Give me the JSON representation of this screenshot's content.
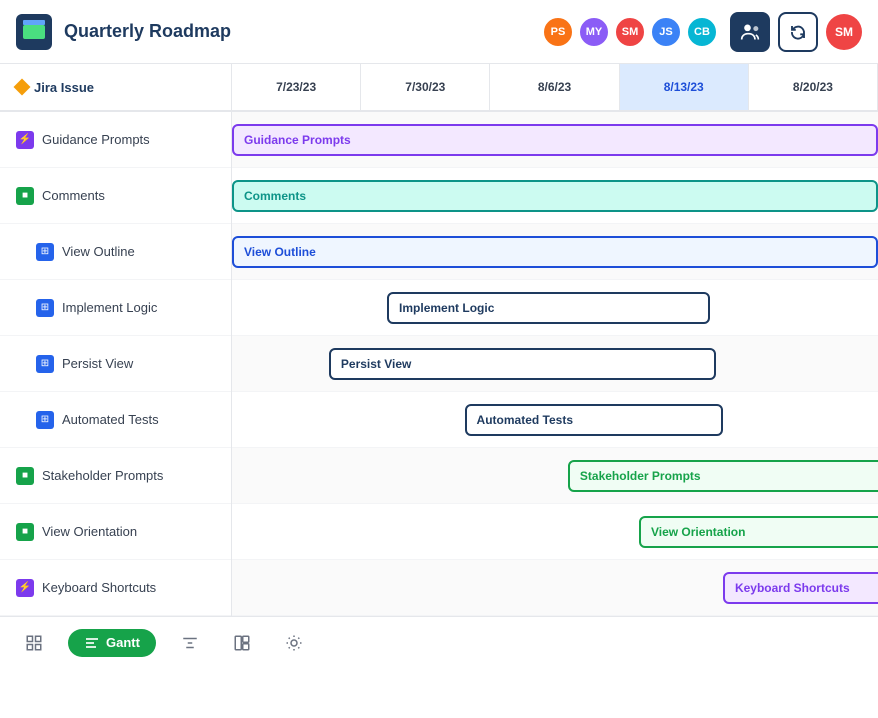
{
  "header": {
    "logo_alt": "App Logo",
    "title": "Quarterly Roadmap",
    "avatars": [
      {
        "initials": "PS",
        "color_class": "avatar-ps"
      },
      {
        "initials": "MY",
        "color_class": "avatar-my"
      },
      {
        "initials": "SM",
        "color_class": "avatar-sm"
      },
      {
        "initials": "JS",
        "color_class": "avatar-js"
      },
      {
        "initials": "CB",
        "color_class": "avatar-cb"
      }
    ],
    "user_initials": "SM"
  },
  "columns": {
    "sidebar_label": "Jira Issue",
    "dates": [
      "7/23/23",
      "7/30/23",
      "8/6/23",
      "8/13/23",
      "8/20/23"
    ]
  },
  "rows": [
    {
      "label": "Guidance Prompts",
      "indent": 0,
      "icon_type": "purple",
      "icon_symbol": "⚡"
    },
    {
      "label": "Comments",
      "indent": 0,
      "icon_type": "green",
      "icon_symbol": "■"
    },
    {
      "label": "View Outline",
      "indent": 1,
      "icon_type": "blue",
      "icon_symbol": "⊞"
    },
    {
      "label": "Implement Logic",
      "indent": 1,
      "icon_type": "blue",
      "icon_symbol": "⊞"
    },
    {
      "label": "Persist View",
      "indent": 1,
      "icon_type": "blue",
      "icon_symbol": "⊞"
    },
    {
      "label": "Automated Tests",
      "indent": 1,
      "icon_type": "blue",
      "icon_symbol": "⊞"
    },
    {
      "label": "Stakeholder Prompts",
      "indent": 0,
      "icon_type": "green",
      "icon_symbol": "■"
    },
    {
      "label": "View Orientation",
      "indent": 0,
      "icon_type": "green",
      "icon_symbol": "■"
    },
    {
      "label": "Keyboard Shortcuts",
      "indent": 0,
      "icon_type": "purple",
      "icon_symbol": "⚡"
    }
  ],
  "bars": [
    {
      "row": 0,
      "label": "Guidance Prompts",
      "style": "bar-purple",
      "left_pct": 0,
      "width_pct": 100
    },
    {
      "row": 1,
      "label": "Comments",
      "style": "bar-teal",
      "left_pct": 0,
      "width_pct": 100
    },
    {
      "row": 2,
      "label": "View Outline",
      "style": "bar-blue-outline",
      "left_pct": 0,
      "width_pct": 100
    },
    {
      "row": 3,
      "label": "Implement Logic",
      "style": "bar-dark-blue",
      "left_pct": 28,
      "width_pct": 50
    },
    {
      "row": 4,
      "label": "Persist View",
      "style": "bar-dark-blue",
      "left_pct": 18,
      "width_pct": 59
    },
    {
      "row": 5,
      "label": "Automated Tests",
      "style": "bar-dark-blue",
      "left_pct": 38,
      "width_pct": 38
    },
    {
      "row": 6,
      "label": "Stakeholder Prompts",
      "style": "bar-green-outline",
      "left_pct": 50,
      "width_pct": 50
    },
    {
      "row": 7,
      "label": "View Orientation",
      "style": "bar-green-outline",
      "left_pct": 62,
      "width_pct": 38
    },
    {
      "row": 8,
      "label": "Keyboard Shortcuts",
      "style": "bar-purple",
      "left_pct": 76,
      "width_pct": 24
    }
  ],
  "toolbar": {
    "gantt_label": "Gantt",
    "active_view": "gantt"
  }
}
